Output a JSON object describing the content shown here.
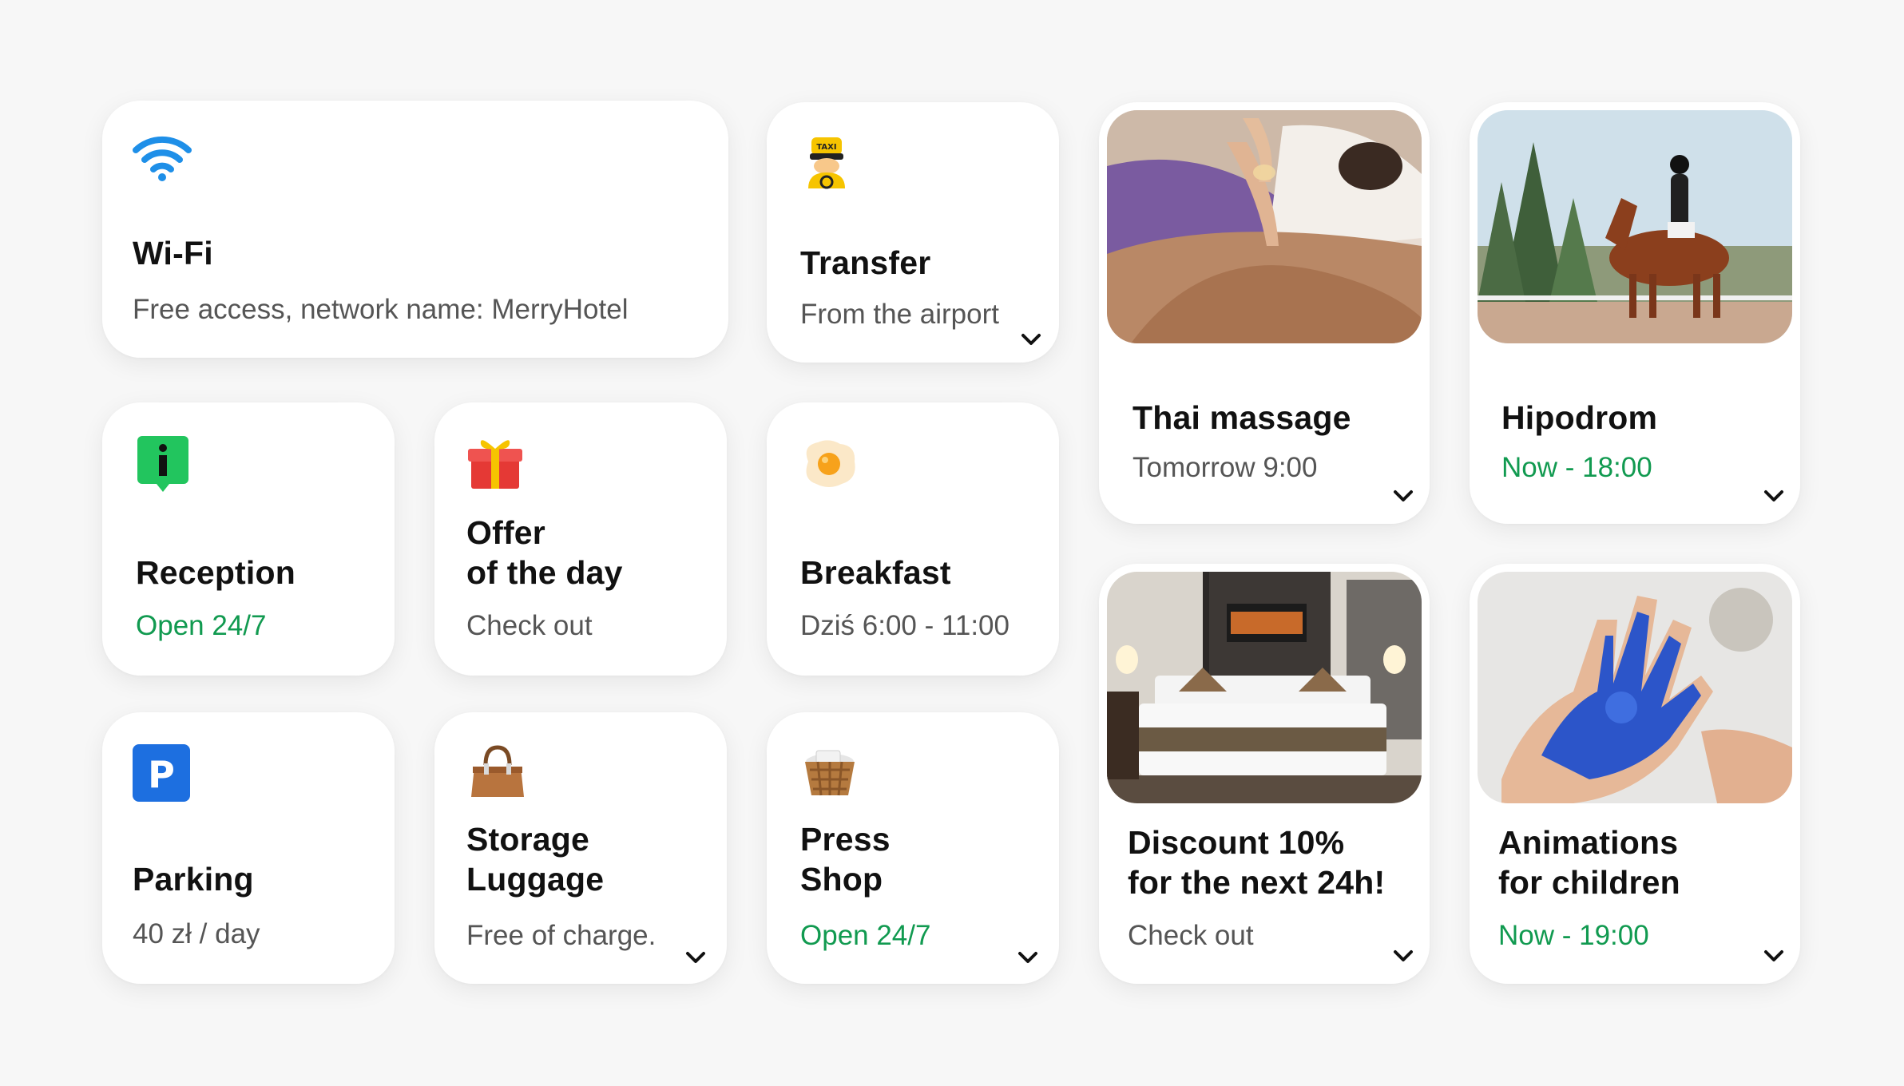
{
  "cards": {
    "wifi": {
      "icon": "wifi-icon",
      "title": "Wi-Fi",
      "subtitle": "Free access, network name: MerryHotel"
    },
    "transfer": {
      "icon": "taxi-driver-icon",
      "title": "Transfer",
      "subtitle": "From the airport"
    },
    "massage": {
      "image": "thai-massage-photo",
      "title": "Thai massage",
      "subtitle": "Tomorrow 9:00"
    },
    "hipodrom": {
      "image": "horse-rider-photo",
      "title": "Hipodrom",
      "subtitle": "Now - 18:00"
    },
    "reception": {
      "icon": "info-icon",
      "title": "Reception",
      "subtitle": "Open 24/7"
    },
    "offer": {
      "icon": "gift-icon",
      "title": "Offer\nof the day",
      "subtitle": "Check out"
    },
    "breakfast": {
      "icon": "fried-egg-icon",
      "title": "Breakfast",
      "subtitle": "Dziś 6:00 - 11:00"
    },
    "discount": {
      "image": "hotel-room-photo",
      "title": "Discount 10%\nfor the next 24h!",
      "subtitle": "Check out"
    },
    "animations": {
      "image": "painted-hand-photo",
      "title": "Animations\nfor children",
      "subtitle": "Now - 19:00"
    },
    "parking": {
      "icon": "parking-icon",
      "title": "Parking",
      "subtitle": "40 zł / day"
    },
    "luggage": {
      "icon": "handbag-icon",
      "title": "Storage\nLuggage",
      "subtitle": "Free of charge."
    },
    "press": {
      "icon": "basket-icon",
      "title": "Press\nShop",
      "subtitle": "Open 24/7"
    }
  },
  "colors": {
    "accent_green": "#119a50",
    "text_dark": "#111111",
    "text_muted": "#555555",
    "background": "#f7f7f7"
  }
}
